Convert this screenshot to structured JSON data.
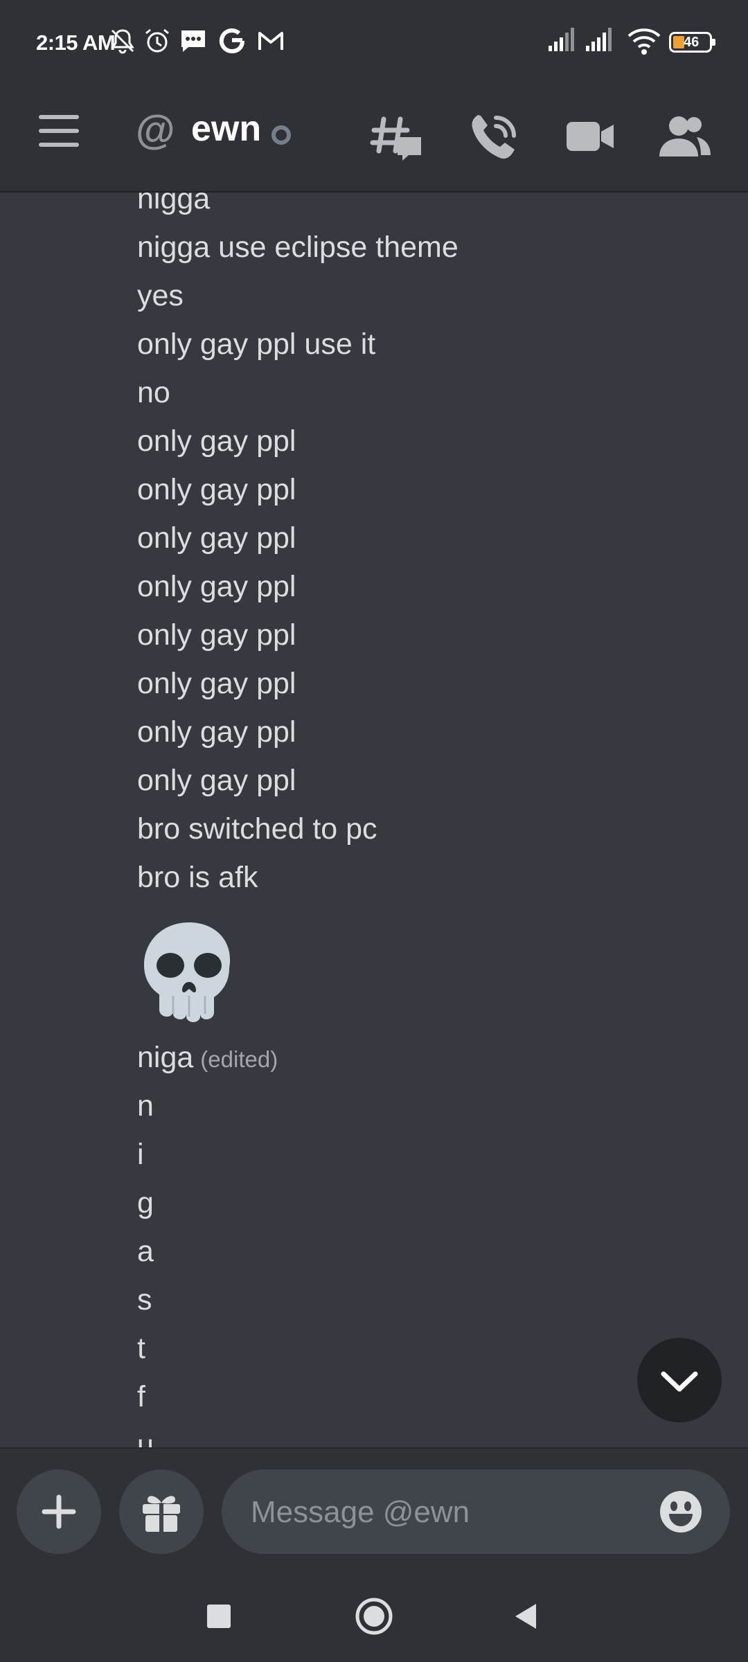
{
  "status_bar": {
    "time": "2:15 AM",
    "battery": "46",
    "icons": [
      "notifications-off-icon",
      "alarm-icon",
      "messages-icon",
      "google-icon",
      "gmail-icon",
      "signal-icon",
      "signal-icon",
      "wifi-icon",
      "battery-icon"
    ]
  },
  "header": {
    "at_symbol": "@",
    "title": "ewn",
    "icons": [
      "menu-icon",
      "threads-icon",
      "call-icon",
      "video-icon",
      "members-icon"
    ]
  },
  "messages": [
    {
      "text": "nigga"
    },
    {
      "text": "nigga use eclipse theme"
    },
    {
      "text": "yes"
    },
    {
      "text": "only gay ppl use it"
    },
    {
      "text": "no"
    },
    {
      "text": "only gay ppl"
    },
    {
      "text": "only gay ppl"
    },
    {
      "text": "only gay ppl"
    },
    {
      "text": "only gay ppl"
    },
    {
      "text": "only gay ppl"
    },
    {
      "text": "only gay ppl"
    },
    {
      "text": "only gay ppl"
    },
    {
      "text": "only gay ppl"
    },
    {
      "text": "bro switched to pc"
    },
    {
      "text": "bro is afk"
    },
    {
      "text": "",
      "emoji": "skull-icon"
    },
    {
      "text": "niga",
      "edited": "(edited)"
    },
    {
      "text": "n"
    },
    {
      "text": "i"
    },
    {
      "text": "g"
    },
    {
      "text": "a"
    },
    {
      "text": "s"
    },
    {
      "text": "t"
    },
    {
      "text": "f"
    },
    {
      "text": "u"
    }
  ],
  "composer": {
    "placeholder": "Message @ewn",
    "icons": [
      "add-icon",
      "gift-icon",
      "emoji-icon"
    ]
  },
  "navigation": {
    "icons": [
      "recents-icon",
      "home-icon",
      "back-icon"
    ]
  },
  "colors": {
    "background": "#36393f",
    "header": "#2f3136",
    "input": "#40444b",
    "text": "#dcddde"
  }
}
